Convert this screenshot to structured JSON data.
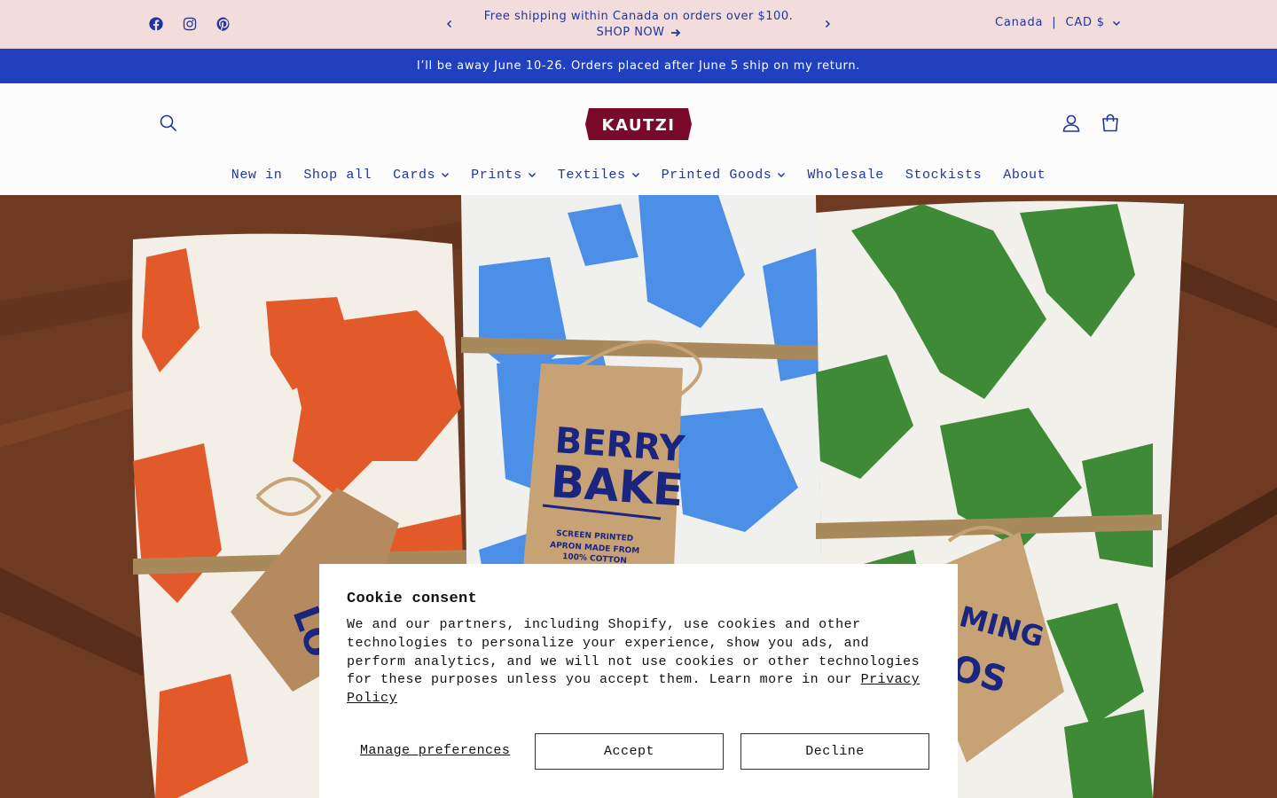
{
  "announcement": {
    "text": "Free shipping within Canada on orders over $100.",
    "link_label": "SHOP NOW",
    "prev_icon": "chevron-left-icon",
    "next_icon": "chevron-right-icon"
  },
  "social": {
    "icons": [
      "facebook-icon",
      "instagram-icon",
      "pinterest-icon"
    ]
  },
  "locale": {
    "country": "Canada",
    "separator": "|",
    "currency": "CAD $"
  },
  "notice": {
    "text": "I’ll be away June 10-26. Orders placed after June 5 ship on my return."
  },
  "header": {
    "logo_text": "KAUTZI",
    "search_icon": "search-icon",
    "account_icon": "account-icon",
    "cart_icon": "cart-icon"
  },
  "nav": {
    "items": [
      {
        "label": "New in"
      },
      {
        "label": "Shop all"
      },
      {
        "label": "Cards"
      },
      {
        "label": "Prints"
      },
      {
        "label": "Textiles"
      },
      {
        "label": "Printed Goods"
      },
      {
        "label": "Wholesale"
      },
      {
        "label": "Stockists"
      },
      {
        "label": "About"
      }
    ]
  },
  "hero": {
    "tag_center_line1": "BERRY",
    "tag_center_line2": "BAKE",
    "tag_center_small": [
      "SCREEN PRINTED",
      "APRON MADE FROM",
      "100% COTTON"
    ],
    "tag_right_text": "MING",
    "tag_right_text2": "OS",
    "tag_left_text": "LO"
  },
  "cookie": {
    "title": "Cookie consent",
    "body": "We and our partners, including Shopify, use cookies and other technologies to personalize your experience, show you ads, and perform analytics, and we will not use cookies or other technologies for these purposes unless you accept them. Learn more in our ",
    "policy_link": "Privacy Policy",
    "manage_label": "Manage preferences",
    "accept_label": "Accept",
    "decline_label": "Decline"
  },
  "colors": {
    "announce_bg": "#f2dcdc",
    "notice_bg": "#2040c0",
    "brand_blue": "#2035a0",
    "logo_bg": "#7a0a2a"
  }
}
